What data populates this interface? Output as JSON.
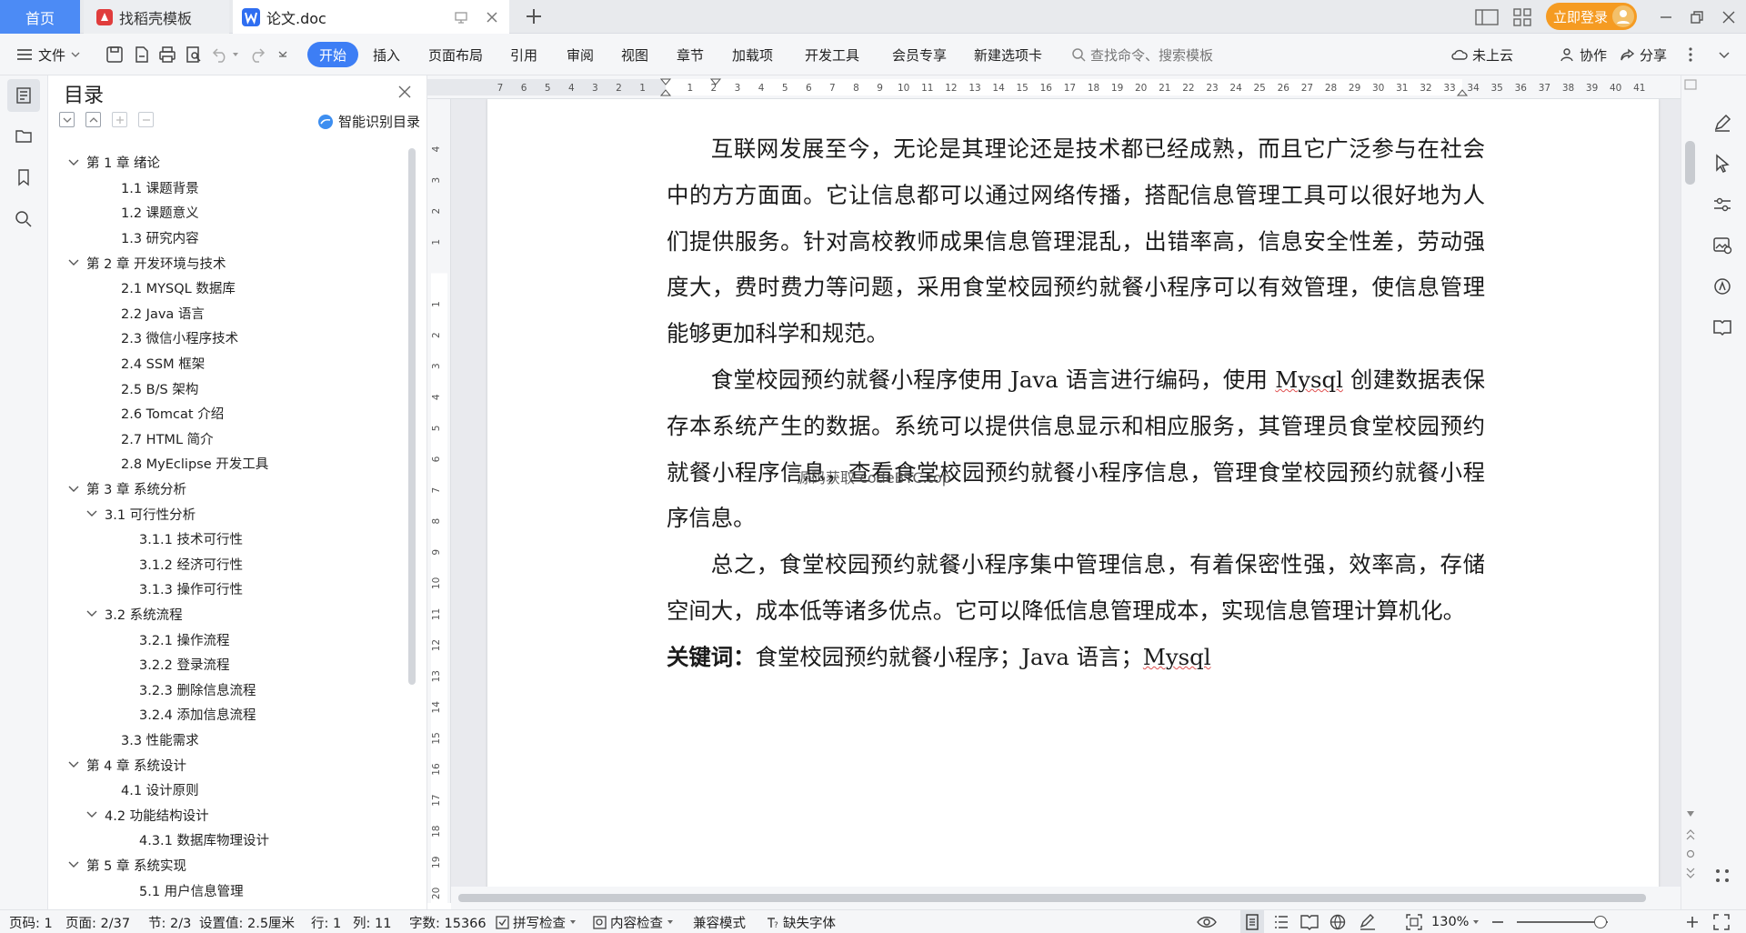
{
  "tabs": {
    "home": "首页",
    "template": "找稻壳模板",
    "document": "论文.doc",
    "login": "立即登录"
  },
  "menu": {
    "file": "文件",
    "items": [
      "开始",
      "插入",
      "页面布局",
      "引用",
      "审阅",
      "视图",
      "章节",
      "加载项",
      "开发工具",
      "会员专享",
      "新建选项卡"
    ],
    "search_placeholder": "查找命令、搜索模板",
    "cloud": "未上云",
    "collab": "协作",
    "share": "分享"
  },
  "toc": {
    "title": "目录",
    "smart": "智能识别目录",
    "items": [
      {
        "label": "第 1 章  绪论",
        "level": 0,
        "expanded": true
      },
      {
        "label": "1.1  课题背景",
        "level": 1
      },
      {
        "label": "1.2  课题意义",
        "level": 1
      },
      {
        "label": "1.3  研究内容",
        "level": 1
      },
      {
        "label": "第 2 章  开发环境与技术",
        "level": 0,
        "expanded": true
      },
      {
        "label": "2.1 MYSQL 数据库",
        "level": 1
      },
      {
        "label": "2.2 Java 语言",
        "level": 1
      },
      {
        "label": "2.3  微信小程序技术",
        "level": 1
      },
      {
        "label": "2.4 SSM 框架",
        "level": 1
      },
      {
        "label": "2.5 B/S 架构",
        "level": 1
      },
      {
        "label": "2.6 Tomcat  介绍",
        "level": 1
      },
      {
        "label": "2.7 HTML 简介",
        "level": 1
      },
      {
        "label": "2.8 MyEclipse 开发工具",
        "level": 1
      },
      {
        "label": "第 3 章  系统分析",
        "level": 0,
        "expanded": true
      },
      {
        "label": "3.1  可行性分析",
        "level": 1,
        "expanded": true
      },
      {
        "label": "3.1.1  技术可行性",
        "level": 2
      },
      {
        "label": "3.1.2  经济可行性",
        "level": 2
      },
      {
        "label": "3.1.3  操作可行性",
        "level": 2
      },
      {
        "label": "3.2  系统流程",
        "level": 1,
        "expanded": true
      },
      {
        "label": "3.2.1  操作流程",
        "level": 2
      },
      {
        "label": "3.2.2  登录流程",
        "level": 2
      },
      {
        "label": "3.2.3  删除信息流程",
        "level": 2
      },
      {
        "label": "3.2.4  添加信息流程",
        "level": 2
      },
      {
        "label": "3.3  性能需求",
        "level": 1
      },
      {
        "label": "第 4 章  系统设计",
        "level": 0,
        "expanded": true
      },
      {
        "label": "4.1  设计原则",
        "level": 1
      },
      {
        "label": "4.2  功能结构设计",
        "level": 1,
        "expanded": true
      },
      {
        "label": "4.3.1  数据库物理设计",
        "level": 2
      },
      {
        "label": "第 5 章  系统实现",
        "level": 0,
        "expanded": true
      },
      {
        "label": "5.1 用户信息管理",
        "level": 2
      }
    ]
  },
  "ruler": {
    "h": [
      "7",
      "6",
      "5",
      "4",
      "3",
      "2",
      "1",
      "",
      "1",
      "2",
      "3",
      "4",
      "5",
      "6",
      "7",
      "8",
      "9",
      "10",
      "11",
      "12",
      "13",
      "14",
      "15",
      "16",
      "17",
      "18",
      "19",
      "20",
      "21",
      "22",
      "23",
      "24",
      "25",
      "26",
      "27",
      "28",
      "29",
      "30",
      "31",
      "32",
      "33",
      "34",
      "35",
      "36",
      "37",
      "38",
      "39",
      "40",
      "41"
    ],
    "v": [
      "4",
      "3",
      "2",
      "1",
      "",
      "1",
      "2",
      "3",
      "4",
      "5",
      "6",
      "7",
      "8",
      "9",
      "10",
      "11",
      "12",
      "13",
      "14",
      "15",
      "16",
      "17",
      "18",
      "19",
      "20"
    ]
  },
  "document": {
    "p1": "互联网发展至今，无论是其理论还是技术都已经成熟，而且它广泛参与在社会中的方方面面。它让信息都可以通过网络传播，搭配信息管理工具可以很好地为人们提供服务。针对高校教师成果信息管理混乱，出错率高，信息安全性差，劳动强度大，费时费力等问题，采用食堂校园预约就餐小程序可以有效管理，使信息管理能够更加科学和规范。",
    "p2_a": "食堂校园预约就餐小程序使用 Java 语言进行编码，使用 ",
    "p2_mysql": "Mysql",
    "p2_b": " 创建数据表保存本系统产生的数据。系统可以提供信息显示和相应服务，其管理员食堂校园预约就餐小程序信息，查看食堂校园预约就餐小程序信息，管理食堂校园预约就餐小程序信息。",
    "p3": "总之，食堂校园预约就餐小程序集中管理信息，有着保密性强，效率高，存储空间大，成本低等诸多优点。它可以降低信息管理成本，实现信息管理计算机化。",
    "kw_label": "关键词：",
    "kw_text": "食堂校园预约就餐小程序；Java 语言；",
    "kw_mysql": "Mysql",
    "watermark": "源码获取 codeBTC.top"
  },
  "status": {
    "page_num": "页码: 1",
    "page": "页面: 2/37",
    "section": "节: 2/3",
    "setting": "设置值: 2.5厘米",
    "row": "行: 1",
    "col": "列: 11",
    "words": "字数: 15366",
    "spell": "拼写检查",
    "content": "内容检查",
    "compat": "兼容模式",
    "missing_font": "缺失字体",
    "zoom": "130%"
  },
  "colors": {
    "accent": "#3d7ef5",
    "login": "#f59b22"
  }
}
